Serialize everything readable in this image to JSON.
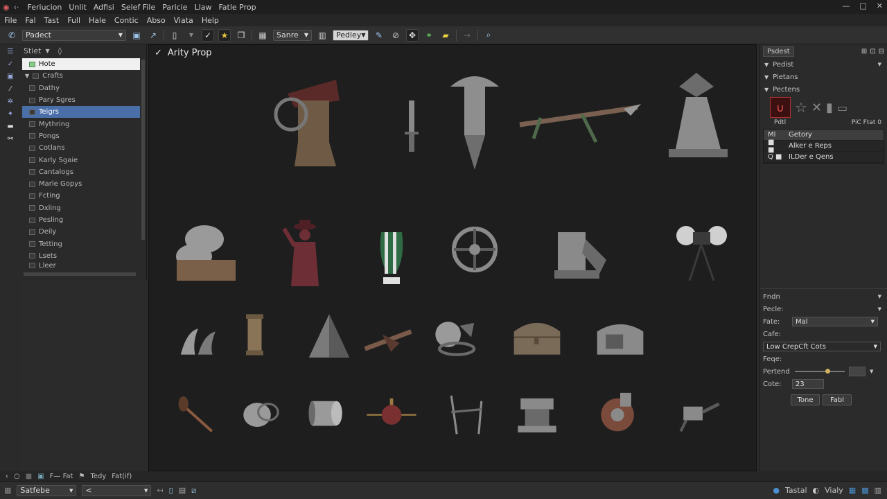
{
  "titlebar": {
    "menu": [
      "Feriucion",
      "Unlit",
      "Adfisi",
      "Selef File",
      "Paricie",
      "Llaw",
      "Fatle Prop"
    ]
  },
  "menubar": {
    "items": [
      "File",
      "Fal",
      "Tast",
      "Full",
      "Hale",
      "Contic",
      "Abso",
      "Viata",
      "Help"
    ]
  },
  "toolbar": {
    "project_dropdown": "Padect",
    "view_dropdown": "Sanre",
    "mode_dropdown": "Pedley"
  },
  "outliner": {
    "header": "Stiet",
    "items": [
      {
        "label": "Hote",
        "state": "white"
      },
      {
        "label": "Crafts",
        "state": "group"
      },
      {
        "label": "Dathy",
        "state": "normal"
      },
      {
        "label": "Pary Sgres",
        "state": "normal"
      },
      {
        "label": "Teigrs",
        "state": "blue"
      },
      {
        "label": "Mythring",
        "state": "normal"
      },
      {
        "label": "Pongs",
        "state": "normal"
      },
      {
        "label": "Cotlans",
        "state": "normal"
      },
      {
        "label": "Karly Sgaie",
        "state": "normal"
      },
      {
        "label": "Cantalogs",
        "state": "normal"
      },
      {
        "label": "Marle Gopys",
        "state": "normal"
      },
      {
        "label": "Fcting",
        "state": "normal"
      },
      {
        "label": "Dxling",
        "state": "normal"
      },
      {
        "label": "Pesling",
        "state": "normal"
      },
      {
        "label": "Deily",
        "state": "normal"
      },
      {
        "label": "Tetting",
        "state": "normal"
      },
      {
        "label": "Lsets",
        "state": "normal"
      },
      {
        "label": "Lleer",
        "state": "normal"
      }
    ]
  },
  "viewport": {
    "title": "Arity Prop",
    "assets": [
      {
        "name": "shrine-gear",
        "color": "#6e5a45",
        "accent": "#5a2a28"
      },
      {
        "name": "dagger",
        "color": "#8a8a8a",
        "accent": "#6a6a6a"
      },
      {
        "name": "pagoda-pillar",
        "color": "#8e8e8e",
        "accent": "#6e6e6e"
      },
      {
        "name": "branch-spear",
        "color": "#7a6050",
        "accent": "#4e6a4a"
      },
      {
        "name": "spiked-pedestal",
        "color": "#8c8c8c",
        "accent": "#6c6c6c"
      },
      {
        "name": "sack-pile",
        "color": "#7a6048",
        "accent": "#9a9a9a"
      },
      {
        "name": "hat-figure",
        "color": "#6e2e36",
        "accent": "#4e2026"
      },
      {
        "name": "striped-vase",
        "color": "#2e6a44",
        "accent": "#e0e0e0"
      },
      {
        "name": "ship-wheel",
        "color": "#8a8a8a",
        "accent": "#5a5a5a"
      },
      {
        "name": "machine-block",
        "color": "#8a8a8a",
        "accent": "#6a6a6a"
      },
      {
        "name": "orb-tripod",
        "color": "#d0d0d0",
        "accent": "#3a3a3a"
      },
      {
        "name": "horns",
        "color": "#9a9a9a",
        "accent": "#7a7a7a"
      },
      {
        "name": "column",
        "color": "#8a7458",
        "accent": "#6a5840"
      },
      {
        "name": "stone-pyramid",
        "color": "#7a7a7a",
        "accent": "#5a5a5a"
      },
      {
        "name": "rocket-spear",
        "color": "#7a5a48",
        "accent": "#5a3a30"
      },
      {
        "name": "cylinder-ring",
        "color": "#9a9a9a",
        "accent": "#6a6a6a"
      },
      {
        "name": "treasure-chest",
        "color": "#7a6a58",
        "accent": "#5a4a3a"
      },
      {
        "name": "barrel-box",
        "color": "#8a8a8a",
        "accent": "#5a5a5a"
      },
      {
        "name": "hammer",
        "color": "#8a5a40",
        "accent": "#5a3a28"
      },
      {
        "name": "round-ring",
        "color": "#9a9a9a",
        "accent": "#6a6a6a"
      },
      {
        "name": "drum",
        "color": "#9a9a9a",
        "accent": "#6a6a6a"
      },
      {
        "name": "spindle-ball",
        "color": "#7a3030",
        "accent": "#9a7a40"
      },
      {
        "name": "wood-frame",
        "color": "#8a8a8a",
        "accent": "#6a6a6a"
      },
      {
        "name": "stone-altar",
        "color": "#8a8a8a",
        "accent": "#6a6a6a"
      },
      {
        "name": "gear-engine",
        "color": "#7a4a3a",
        "accent": "#8a8a8a"
      },
      {
        "name": "mech-arm",
        "color": "#8a8a8a",
        "accent": "#5a5a5a"
      }
    ]
  },
  "rightpanel": {
    "tabs": [
      "Psdest"
    ],
    "sections": [
      "Pedist",
      "Pietans",
      "Pectens"
    ],
    "thumb_caption_left": "Pdtl",
    "thumb_caption_right": "PiC Ftat 0",
    "layers": [
      {
        "flag": "Ml",
        "label": "Getory"
      },
      {
        "flag": "■ ■",
        "label": "Alker e Reps"
      },
      {
        "flag": "Q ■",
        "label": "ILDer e Qens"
      }
    ],
    "props": {
      "row1": "Fndn",
      "row2": "Pecle:",
      "row3_label": "Fate:",
      "row3_value": "Mal",
      "row4": "Cafe:",
      "row5_value": "Low CrepCft Cots",
      "row6": "Feqe:",
      "row7_label": "Pertend",
      "row8_label": "Cote:",
      "row8_value": "23",
      "btn1": "Tone",
      "btn2": "Fabl"
    },
    "slider_value": 0.65
  },
  "statusbar": {
    "text1": "F— Fat",
    "text2": "Tedy",
    "text3": "Fat(if)"
  },
  "bottombar": {
    "dropdown1": "Satfebe",
    "dropdown2": "<",
    "right1": "Tastal",
    "right2": "Vialy"
  }
}
